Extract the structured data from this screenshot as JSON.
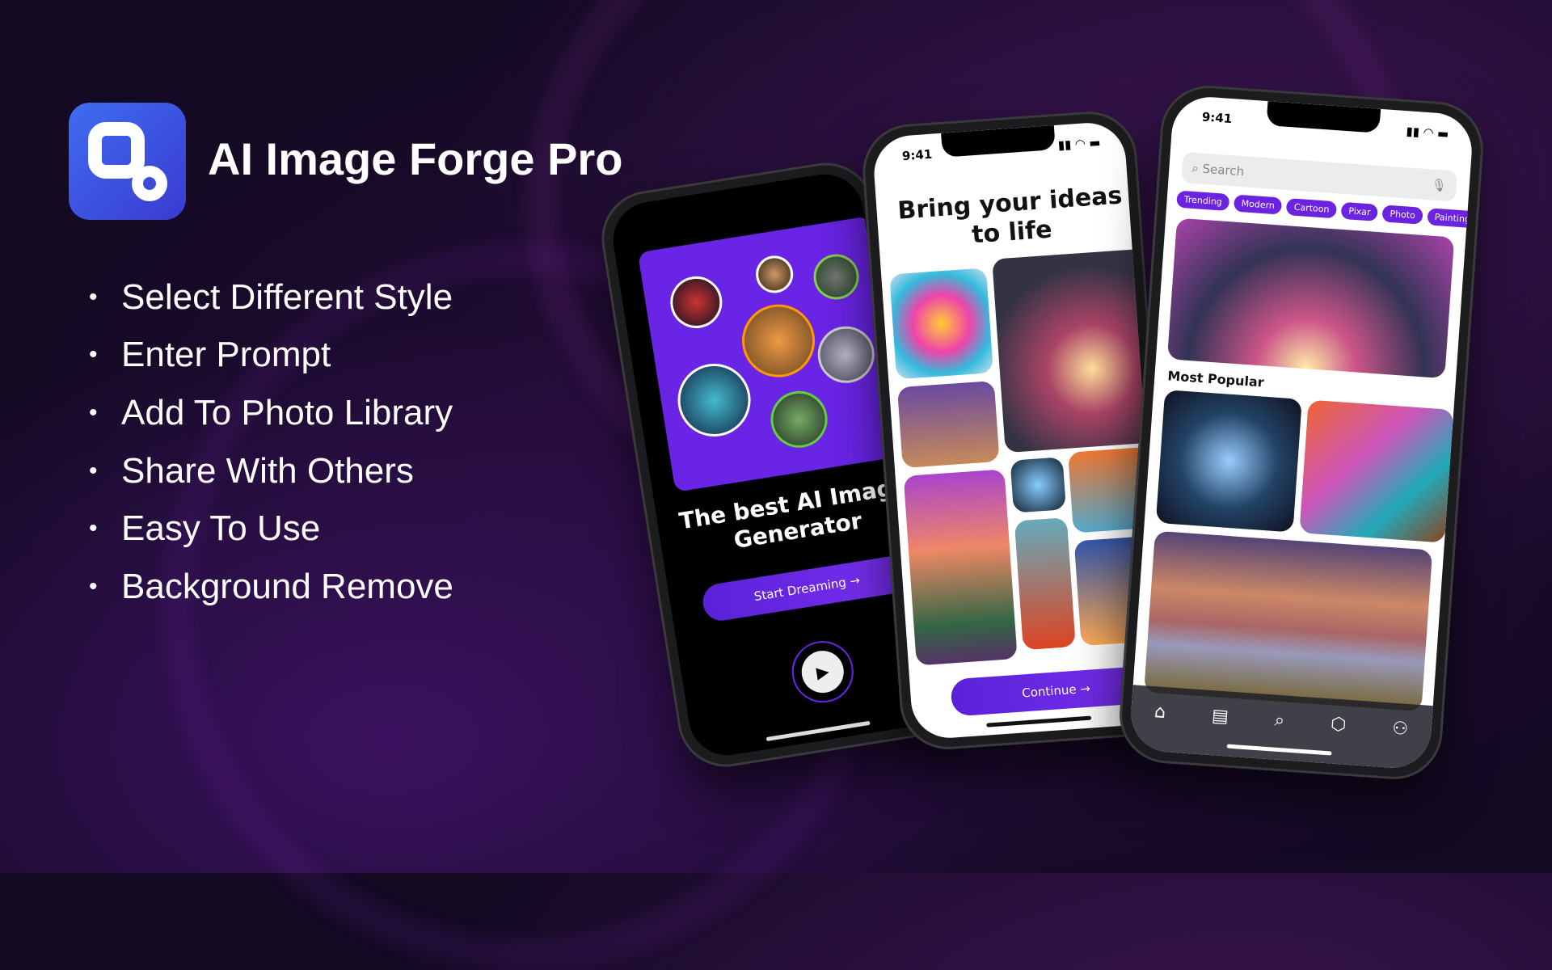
{
  "app": {
    "title": "AI Image Forge Pro",
    "logo_icon": "logo-icon",
    "accent": "#6b23e0"
  },
  "features": [
    "Select Different Style",
    "Enter Prompt",
    "Add To Photo Library",
    "Share With Others",
    "Easy To Use",
    "Background Remove"
  ],
  "phone1": {
    "headline": "The best AI Image Generator",
    "button": "Start Dreaming →"
  },
  "phone2": {
    "time": "9:41",
    "headline": "Bring your ideas to life",
    "button": "Continue →"
  },
  "phone3": {
    "time": "9:41",
    "search_placeholder": "Search",
    "chips": [
      "Trending",
      "Modern",
      "Cartoon",
      "Pixar",
      "Photo",
      "Painting"
    ],
    "section": "Most Popular",
    "tabs": [
      "home-icon",
      "document-icon",
      "search-icon",
      "box-icon",
      "binoculars-icon"
    ]
  }
}
